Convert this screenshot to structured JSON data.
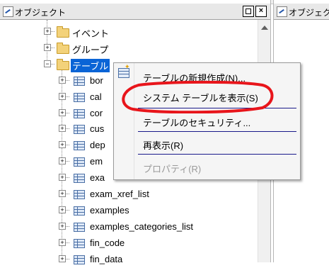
{
  "left_pane": {
    "title": "オブジェクト",
    "max_button": "",
    "close_button": "×"
  },
  "right_pane": {
    "title": "オブジェクト"
  },
  "tree": {
    "items": [
      {
        "label": "イベント",
        "type": "folder",
        "expander": "+"
      },
      {
        "label": "グループ",
        "type": "folder",
        "expander": "+"
      },
      {
        "label": "テーブル",
        "type": "folder",
        "expander": "−",
        "selected": true
      },
      {
        "label": "bor",
        "type": "table",
        "expander": "+"
      },
      {
        "label": "cal",
        "type": "table",
        "expander": "+"
      },
      {
        "label": "cor",
        "type": "table",
        "expander": "+"
      },
      {
        "label": "cus",
        "type": "table",
        "expander": "+"
      },
      {
        "label": "dep",
        "type": "table",
        "expander": "+"
      },
      {
        "label": "em",
        "type": "table",
        "expander": "+"
      },
      {
        "label": "exa",
        "type": "table",
        "expander": "+"
      },
      {
        "label": "exam_xref_list",
        "type": "table",
        "expander": "+"
      },
      {
        "label": "examples",
        "type": "table",
        "expander": "+"
      },
      {
        "label": "examples_categories_list",
        "type": "table",
        "expander": "+"
      },
      {
        "label": "fin_code",
        "type": "table",
        "expander": "+"
      },
      {
        "label": "fin_data",
        "type": "table",
        "expander": "+"
      }
    ]
  },
  "context_menu": {
    "items": [
      {
        "label": "テーブルの新規作成(N)...",
        "enabled": true,
        "icon": "new-table-icon"
      },
      {
        "label": "システム テーブルを表示(S)",
        "enabled": true
      },
      {
        "label": "テーブルのセキュリティ...",
        "enabled": true
      },
      {
        "label": "再表示(R)",
        "enabled": true
      },
      {
        "label": "プロパティ(R)",
        "enabled": false
      }
    ]
  },
  "colors": {
    "selection": "#0a64d6",
    "annotation": "#e8151b",
    "separator": "#1a1a8a"
  }
}
